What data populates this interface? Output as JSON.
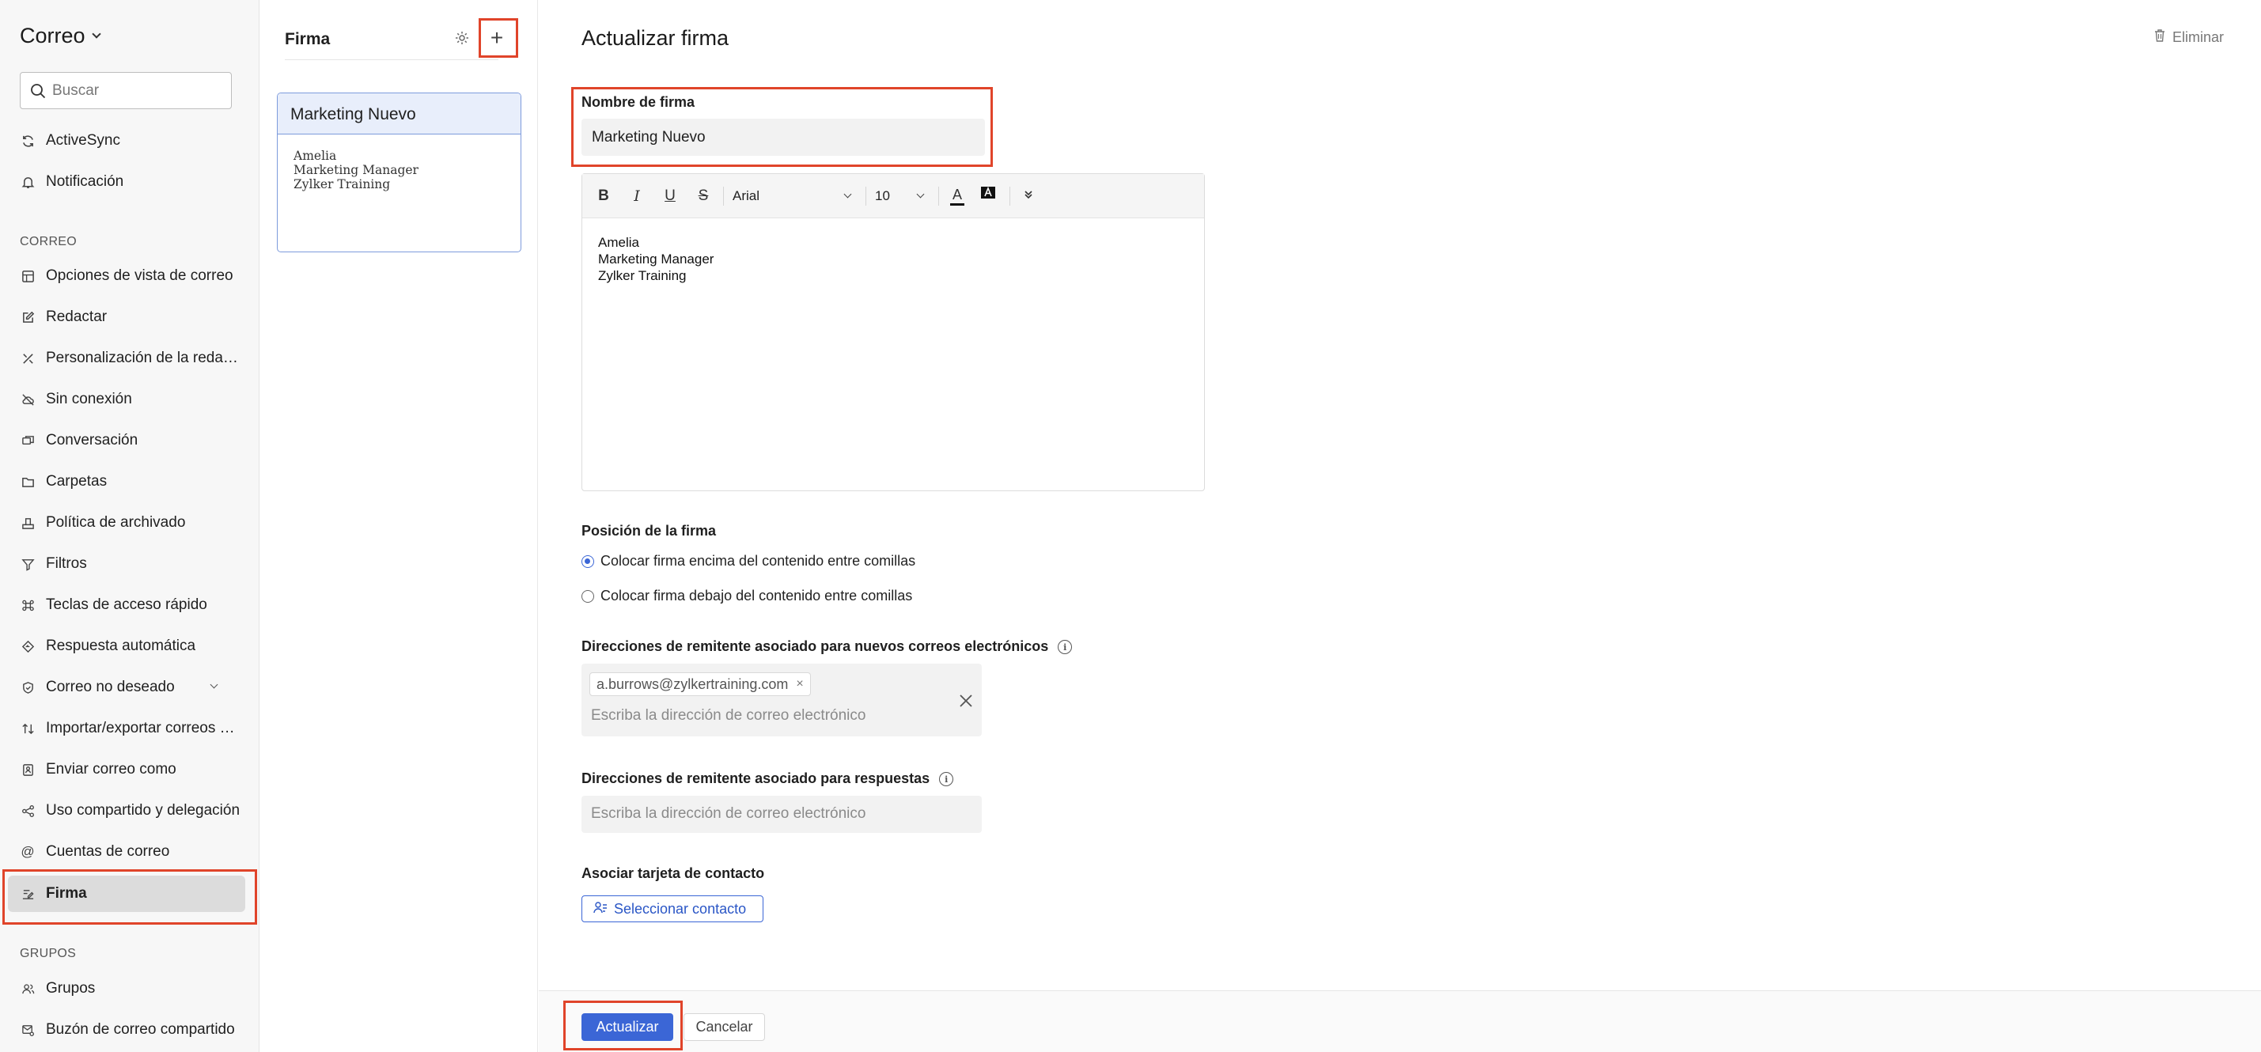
{
  "app": {
    "title": "Correo"
  },
  "search": {
    "placeholder": "Buscar"
  },
  "nav": {
    "top_items": [
      {
        "label": "ActiveSync",
        "icon": "sync-icon"
      },
      {
        "label": "Notificación",
        "icon": "bell-icon"
      }
    ],
    "section_mail": "CORREO",
    "mail_items": [
      {
        "label": "Opciones de vista de correo",
        "icon": "layout-icon"
      },
      {
        "label": "Redactar",
        "icon": "compose-icon"
      },
      {
        "label": "Personalización de la redacción",
        "icon": "customize-icon"
      },
      {
        "label": "Sin conexión",
        "icon": "cloud-off-icon"
      },
      {
        "label": "Conversación",
        "icon": "conversation-icon"
      },
      {
        "label": "Carpetas",
        "icon": "folder-icon"
      },
      {
        "label": "Política de archivado",
        "icon": "archive-icon"
      },
      {
        "label": "Filtros",
        "icon": "filter-icon"
      },
      {
        "label": "Teclas de acceso rápido",
        "icon": "command-icon"
      },
      {
        "label": "Respuesta automática",
        "icon": "auto-reply-icon"
      },
      {
        "label": "Correo no deseado",
        "icon": "shield-icon"
      },
      {
        "label": "Importar/exportar correos electrónicos",
        "icon": "import-export-icon"
      },
      {
        "label": "Enviar correo como",
        "icon": "send-as-icon"
      },
      {
        "label": "Uso compartido y delegación",
        "icon": "share-icon"
      },
      {
        "label": "Cuentas de correo",
        "icon": "at-icon"
      },
      {
        "label": "Firma",
        "icon": "signature-icon"
      }
    ],
    "section_groups": "GRUPOS",
    "group_items": [
      {
        "label": "Grupos",
        "icon": "groups-icon"
      },
      {
        "label": "Buzón de correo compartido",
        "icon": "shared-mailbox-icon"
      }
    ]
  },
  "signature_list": {
    "title": "Firma",
    "add_label": "+",
    "card": {
      "name": "Marketing Nuevo",
      "lines": [
        "Amelia",
        "Marketing Manager",
        "Zylker Training"
      ]
    }
  },
  "main": {
    "title": "Actualizar firma",
    "delete_label": "Eliminar",
    "name_label": "Nombre de firma",
    "name_value": "Marketing Nuevo",
    "toolbar": {
      "bold": "B",
      "italic": "I",
      "underline": "U",
      "strike": "S",
      "font": "Arial",
      "size": "10",
      "text_color": "A"
    },
    "editor_lines": [
      "Amelia",
      "Marketing Manager",
      "Zylker Training"
    ],
    "position_label": "Posición de la firma",
    "position_options": [
      {
        "label": "Colocar firma encima del contenido entre comillas",
        "selected": true
      },
      {
        "label": "Colocar firma debajo del contenido entre comillas",
        "selected": false
      }
    ],
    "new_addr_label": "Direcciones de remitente asociado para nuevos correos electrónicos",
    "new_addr_chip": "a.burrows@zylkertraining.com",
    "addr_placeholder": "Escriba la dirección de correo electrónico",
    "reply_addr_label": "Direcciones de remitente asociado para respuestas",
    "contact_label": "Asociar tarjeta de contacto",
    "contact_button": "Seleccionar contacto",
    "update_button": "Actualizar",
    "cancel_button": "Cancelar"
  },
  "colors": {
    "accent": "#3b66d6",
    "highlight": "#e0442a",
    "selected_bg": "#dcdcdc"
  }
}
